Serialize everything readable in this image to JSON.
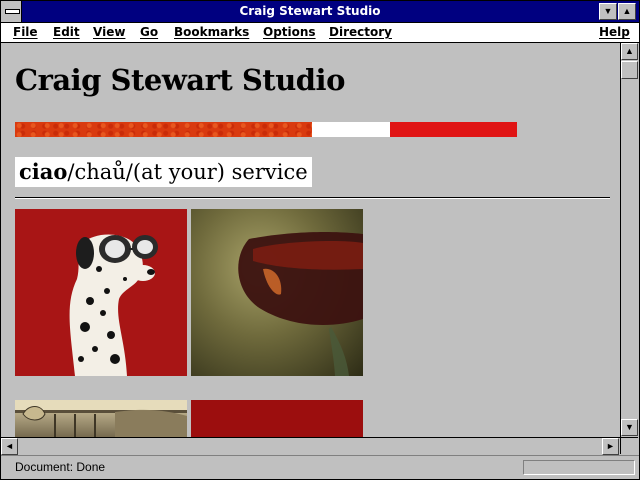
{
  "window": {
    "title": "Craig Stewart Studio"
  },
  "menu": {
    "file": "File",
    "edit": "Edit",
    "view": "View",
    "go": "Go",
    "bookmarks": "Bookmarks",
    "options": "Options",
    "directory": "Directory",
    "help": "Help"
  },
  "content": {
    "heading": "Craig Stewart Studio",
    "ciao_bold": "ciao",
    "ciao_rest": "/chaů/(at your) service",
    "color_bar_colors": [
      "#d93a0f",
      "#ffffff",
      "#e01414"
    ]
  },
  "status": {
    "text": "Document: Done"
  },
  "icons": {
    "system_menu": "system-menu-icon",
    "minimize": "minimize-arrow-icon",
    "maximize": "maximize-arrow-icon",
    "scroll_up": "scroll-up-arrow-icon",
    "scroll_down": "scroll-down-arrow-icon",
    "scroll_left": "scroll-left-arrow-icon",
    "scroll_right": "scroll-right-arrow-icon"
  },
  "colors": {
    "titlebar": "#000080",
    "window": "#c0c0c0",
    "menubar": "#ffffff"
  }
}
